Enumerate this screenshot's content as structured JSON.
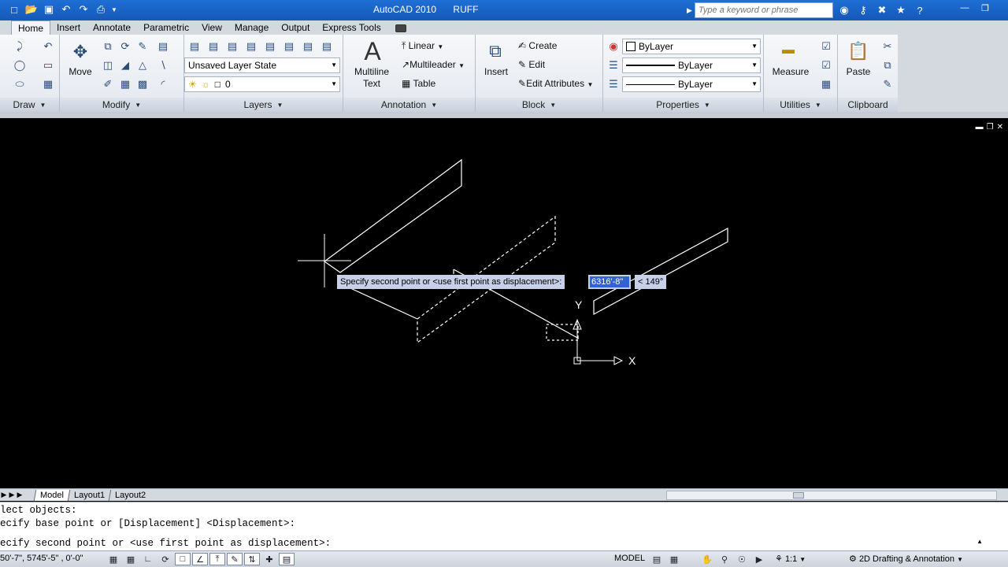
{
  "window": {
    "app_name": "AutoCAD 2010",
    "doc_name": "RUFF",
    "search_placeholder": "Type a keyword or phrase"
  },
  "tabs": [
    {
      "label": "Home",
      "active": true
    },
    {
      "label": "Insert"
    },
    {
      "label": "Annotate"
    },
    {
      "label": "Parametric"
    },
    {
      "label": "View"
    },
    {
      "label": "Manage"
    },
    {
      "label": "Output"
    },
    {
      "label": "Express Tools"
    }
  ],
  "ribbon": {
    "draw": {
      "label": "Draw"
    },
    "modify": {
      "label": "Modify",
      "move_label": "Move"
    },
    "layers": {
      "label": "Layers",
      "layer_state": "Unsaved Layer State",
      "current_layer": "0"
    },
    "annotation": {
      "label": "Annotation",
      "mtext_line1": "Multiline",
      "mtext_line2": "Text",
      "linear": "Linear",
      "multileader": "Multileader",
      "table": "Table"
    },
    "block": {
      "label": "Block",
      "insert": "Insert",
      "create": "Create",
      "edit": "Edit",
      "edit_attributes": "Edit Attributes"
    },
    "properties": {
      "label": "Properties",
      "color": "ByLayer",
      "linetype": "ByLayer",
      "lineweight": "ByLayer"
    },
    "utilities": {
      "label": "Utilities",
      "measure": "Measure"
    },
    "clipboard": {
      "label": "Clipboard",
      "paste": "Paste"
    }
  },
  "drawing": {
    "prompt": "Specify second point or <use first point as displacement>:",
    "distance": "6316'-8\"",
    "angle": "< 149°",
    "ucs_x": "X",
    "ucs_y": "Y"
  },
  "layout_tabs": [
    {
      "label": "Model",
      "active": true
    },
    {
      "label": "Layout1"
    },
    {
      "label": "Layout2"
    }
  ],
  "command_history": [
    "lect objects:",
    "ecify base point or [Displacement] <Displacement>:",
    "ecify second point or <use first point as displacement>:"
  ],
  "status": {
    "coords": "50'-7\", 5745'-5\" , 0'-0\"",
    "space": "MODEL",
    "annotation_scale": "1:1",
    "workspace": "2D Drafting & Annotation"
  }
}
